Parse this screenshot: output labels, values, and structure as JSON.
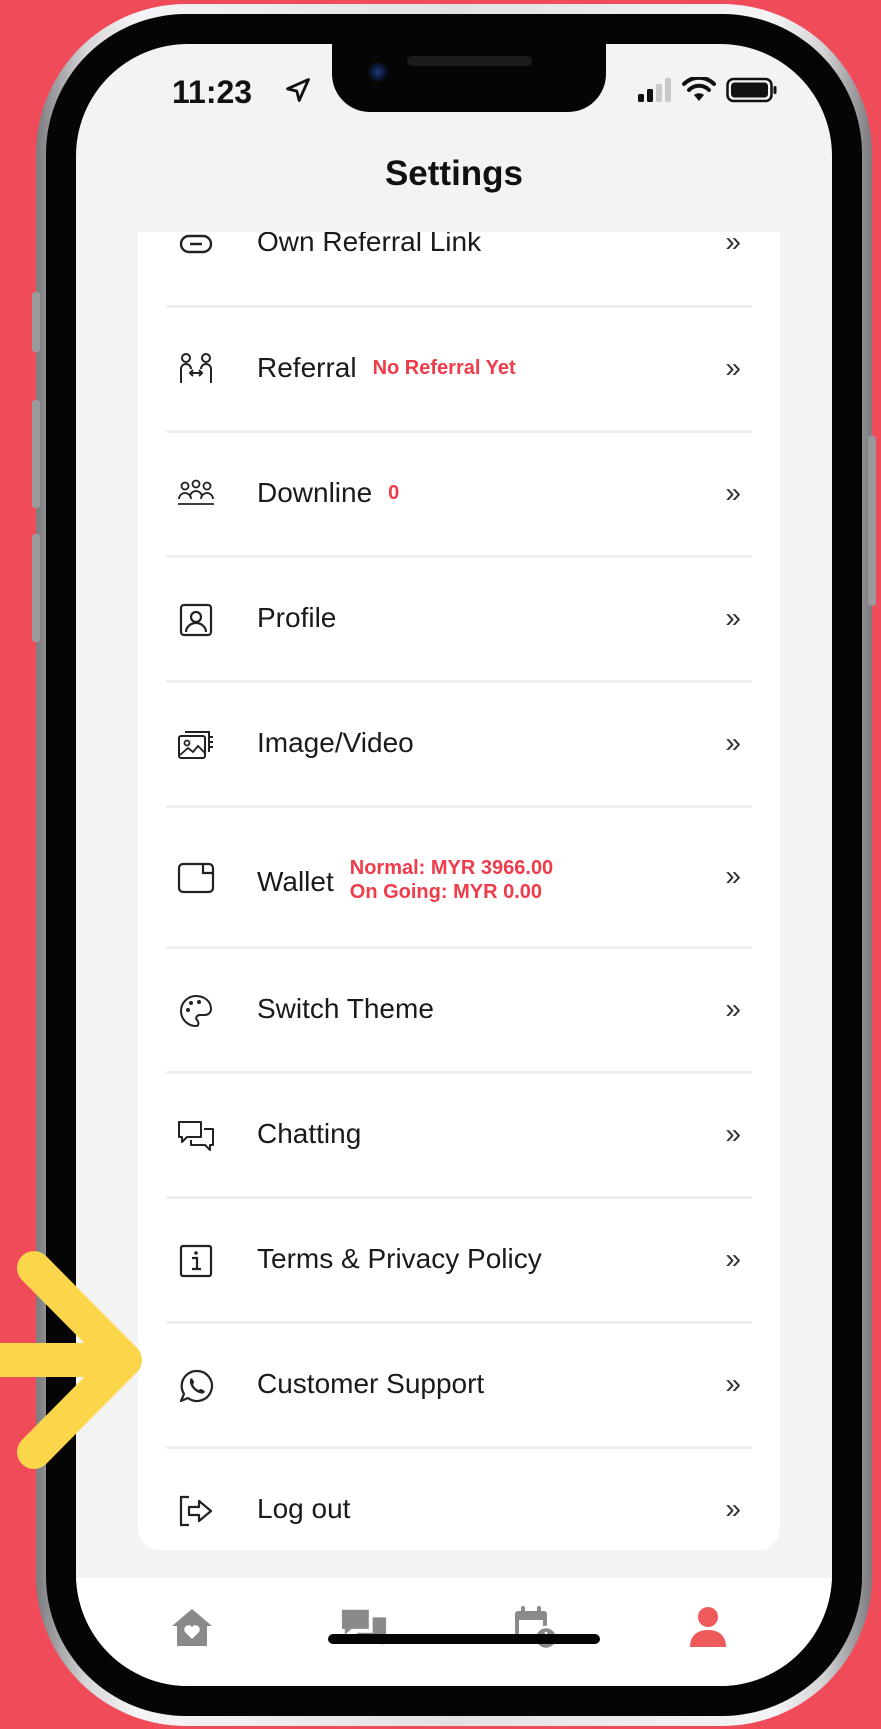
{
  "status_bar": {
    "time": "11:23"
  },
  "header": {
    "title": "Settings"
  },
  "menu": {
    "items": [
      {
        "label": "Own Referral Link",
        "icon": "link-icon"
      },
      {
        "label": "Referral",
        "badge": "No Referral Yet",
        "icon": "referral-icon"
      },
      {
        "label": "Downline",
        "badge": "0",
        "icon": "group-icon"
      },
      {
        "label": "Profile",
        "icon": "profile-icon"
      },
      {
        "label": "Image/Video",
        "icon": "image-video-icon"
      },
      {
        "label": "Wallet",
        "badge_line1": "Normal: MYR 3966.00",
        "badge_line2": "On Going: MYR 0.00",
        "icon": "wallet-icon"
      },
      {
        "label": "Switch Theme",
        "icon": "palette-icon"
      },
      {
        "label": "Chatting",
        "icon": "chat-icon"
      },
      {
        "label": "Terms & Privacy Policy",
        "icon": "info-icon"
      },
      {
        "label": "Customer Support",
        "icon": "whatsapp-icon"
      },
      {
        "label": "Log out",
        "icon": "logout-icon"
      }
    ],
    "chevron": "»"
  },
  "tabbar": {
    "tabs": [
      "home-icon",
      "chat-bubbles-icon",
      "calendar-clock-icon",
      "user-icon"
    ],
    "active_color": "#ef5a5a",
    "inactive_color": "#8a8a8a"
  },
  "colors": {
    "background": "#ef4b59",
    "badge": "#ef3b4a",
    "annotation_arrow": "#fbd64a"
  }
}
